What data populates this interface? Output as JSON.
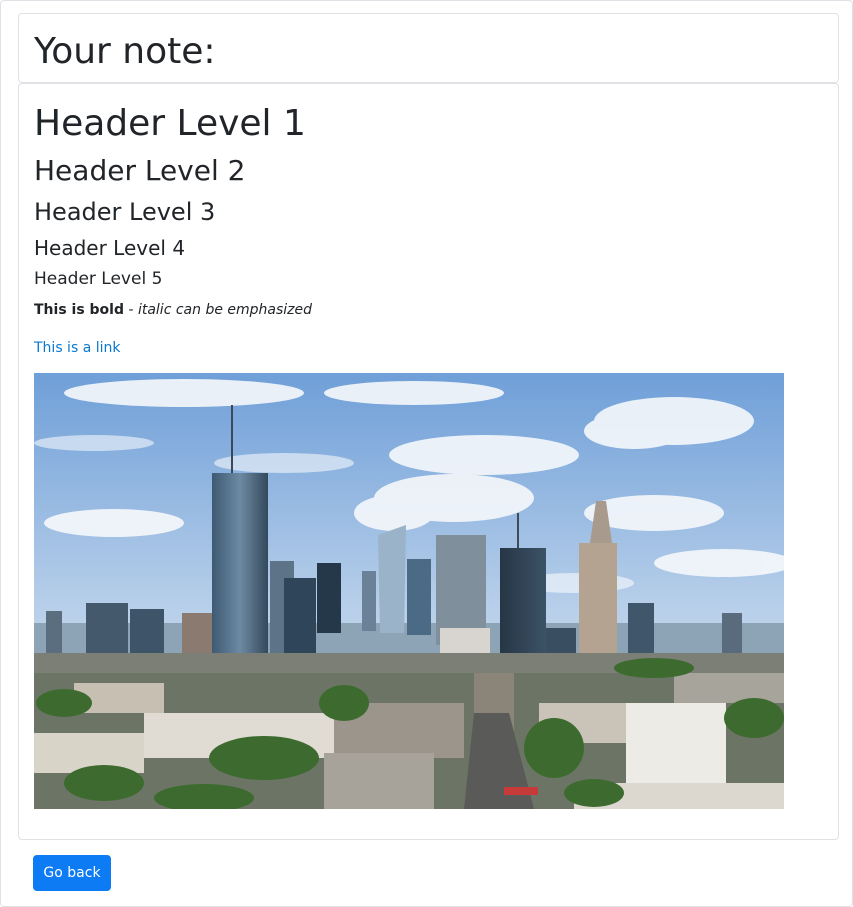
{
  "note": {
    "title": "Your note:"
  },
  "content": {
    "h1": "Header Level 1",
    "h2": "Header Level 2",
    "h3": "Header Level 3",
    "h4": "Header Level 4",
    "h5": "Header Level 5",
    "bold_text": "This is bold",
    "separator": " - ",
    "italic_text": "italic can be emphasized",
    "link_text": "This is a link",
    "image_subject": "city-skyline-photo"
  },
  "actions": {
    "back_label": "Go back"
  },
  "colors": {
    "link": "#0b79d0",
    "button": "#0d7bf4",
    "border": "#dfe1e4"
  }
}
